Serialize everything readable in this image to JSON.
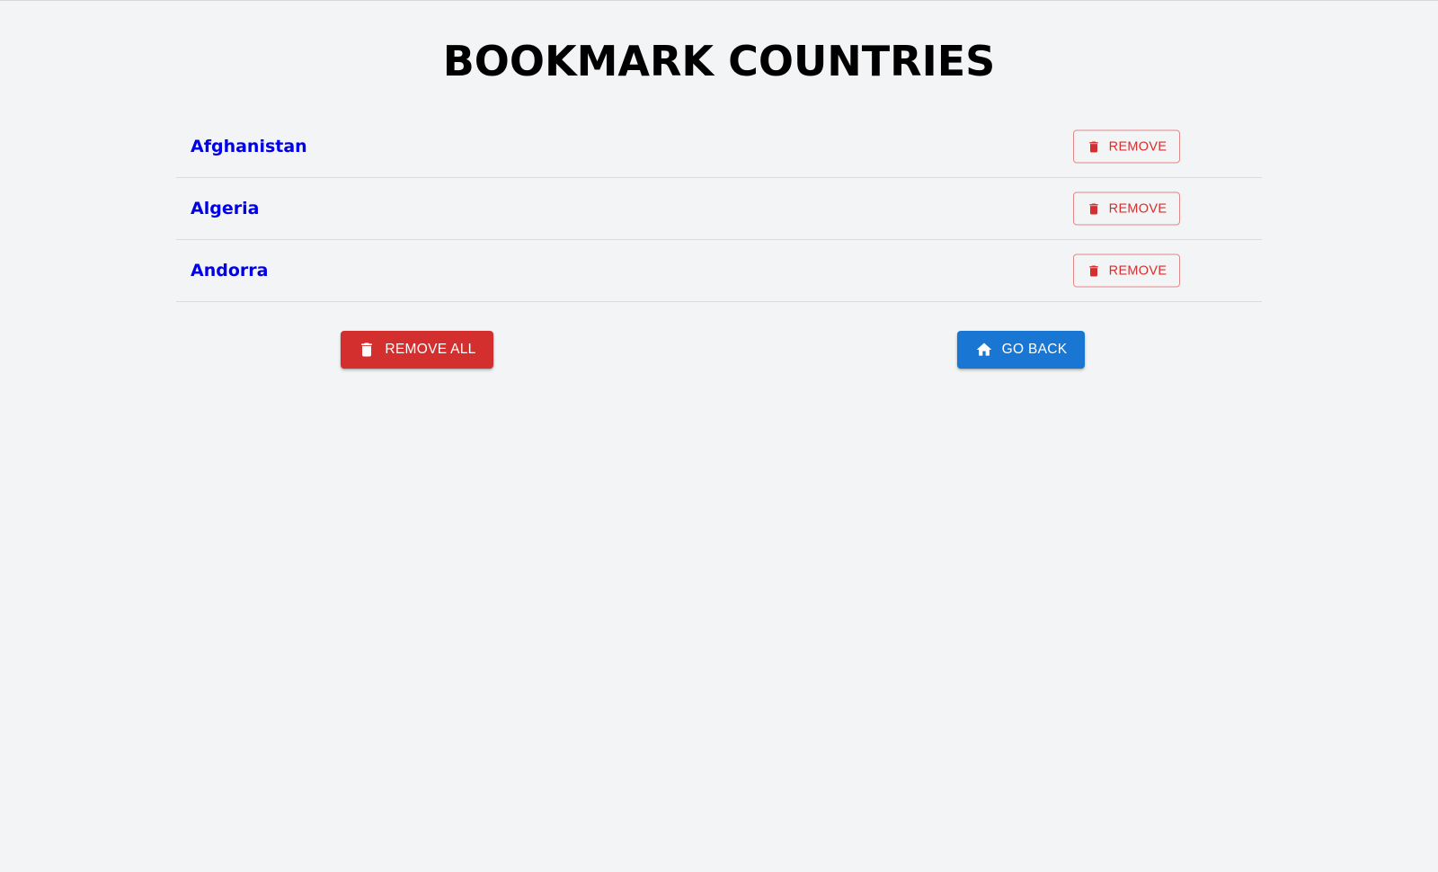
{
  "page": {
    "title": "BOOKMARK COUNTRIES"
  },
  "bookmarks": [
    {
      "country": "Afghanistan",
      "remove_label": "REMOVE"
    },
    {
      "country": "Algeria",
      "remove_label": "REMOVE"
    },
    {
      "country": "Andorra",
      "remove_label": "REMOVE"
    }
  ],
  "actions": {
    "remove_all_label": "REMOVE ALL",
    "remove_all_icon": "trash-icon",
    "go_back_label": "GO BACK",
    "go_back_icon": "home-icon"
  },
  "colors": {
    "background": "#f3f4f6",
    "link": "#0000e6",
    "danger": "#d32f2f",
    "primary": "#1976d2"
  }
}
